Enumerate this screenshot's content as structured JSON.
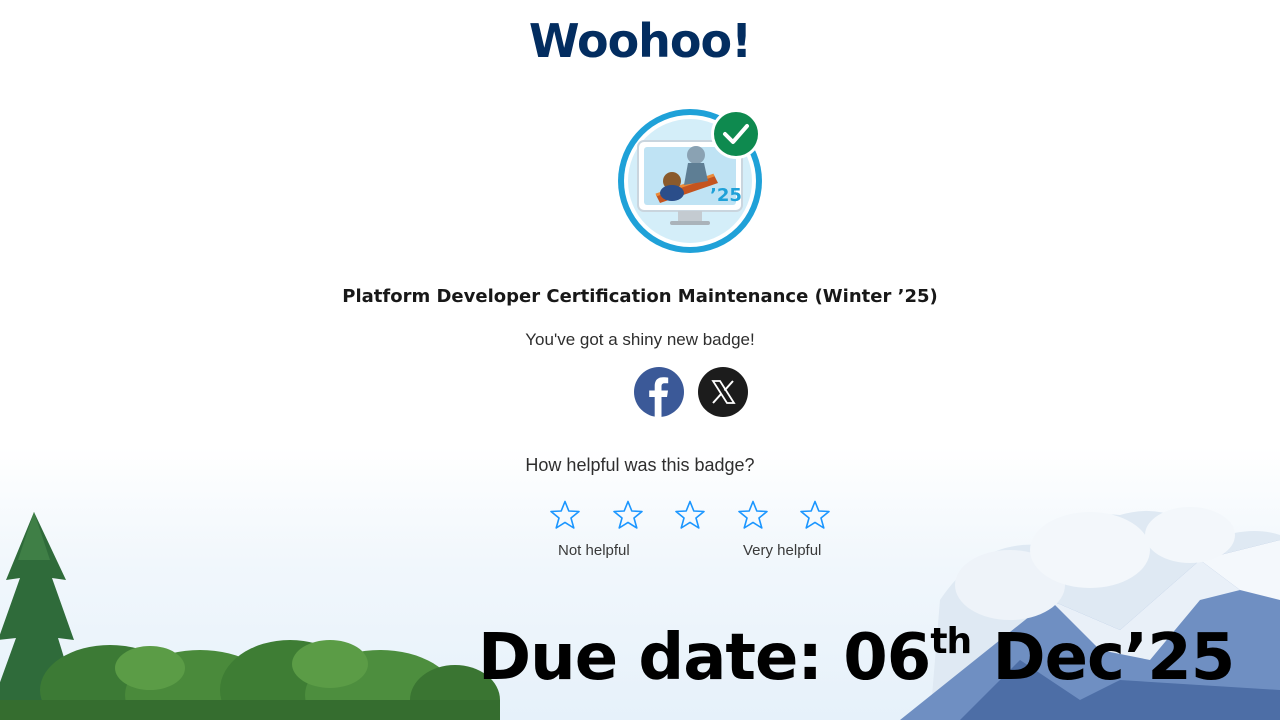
{
  "title": "Woohoo!",
  "badge": {
    "name": "Platform Developer Certification Maintenance (Winter ’25)",
    "year_label": "’25",
    "status_icon": "checkmark-icon"
  },
  "message": "You've got a shiny new badge!",
  "share": [
    {
      "name": "facebook",
      "icon": "facebook-icon",
      "color": "#3b5998"
    },
    {
      "name": "x",
      "icon": "x-icon",
      "color": "#1c1c1c"
    }
  ],
  "rating": {
    "question": "How helpful was this badge?",
    "max": 5,
    "selected": 0,
    "low_label": "Not helpful",
    "high_label": "Very helpful"
  },
  "overlay": {
    "prefix": "Due date: 06",
    "superscript": "th",
    "suffix": " Dec’25"
  },
  "colors": {
    "brand_navy": "#032d60",
    "badge_ring": "#1fa1d8",
    "check_green": "#0e8a4f",
    "star_outline": "#1b96ff"
  }
}
